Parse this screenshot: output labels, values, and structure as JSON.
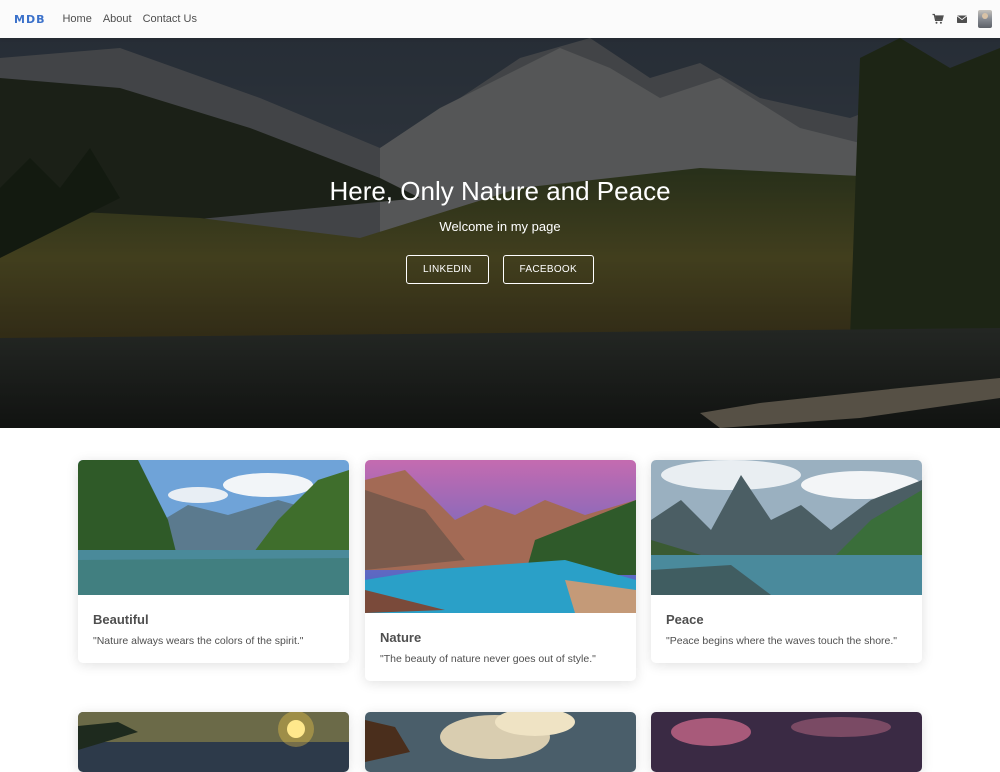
{
  "navbar": {
    "brand": "MDB",
    "links": [
      "Home",
      "About",
      "Contact Us"
    ],
    "icons": [
      "cart-icon",
      "envelope-icon",
      "avatar"
    ]
  },
  "hero": {
    "title": "Here, Only Nature and Peace",
    "subtitle": "Welcome in my page",
    "buttons": [
      "LINKEDIN",
      "FACEBOOK"
    ]
  },
  "cards": [
    {
      "title": "Beautiful",
      "text": "\"Nature always wears the colors of the spirit.\""
    },
    {
      "title": "Nature",
      "text": "\"The beauty of nature never goes out of style.\""
    },
    {
      "title": "Peace",
      "text": "\"Peace begins where the waves touch the shore.\""
    }
  ],
  "colors": {
    "brand": "#3b71ca",
    "text": "#4f4f4f",
    "navbar_bg": "#fbfbfb"
  }
}
